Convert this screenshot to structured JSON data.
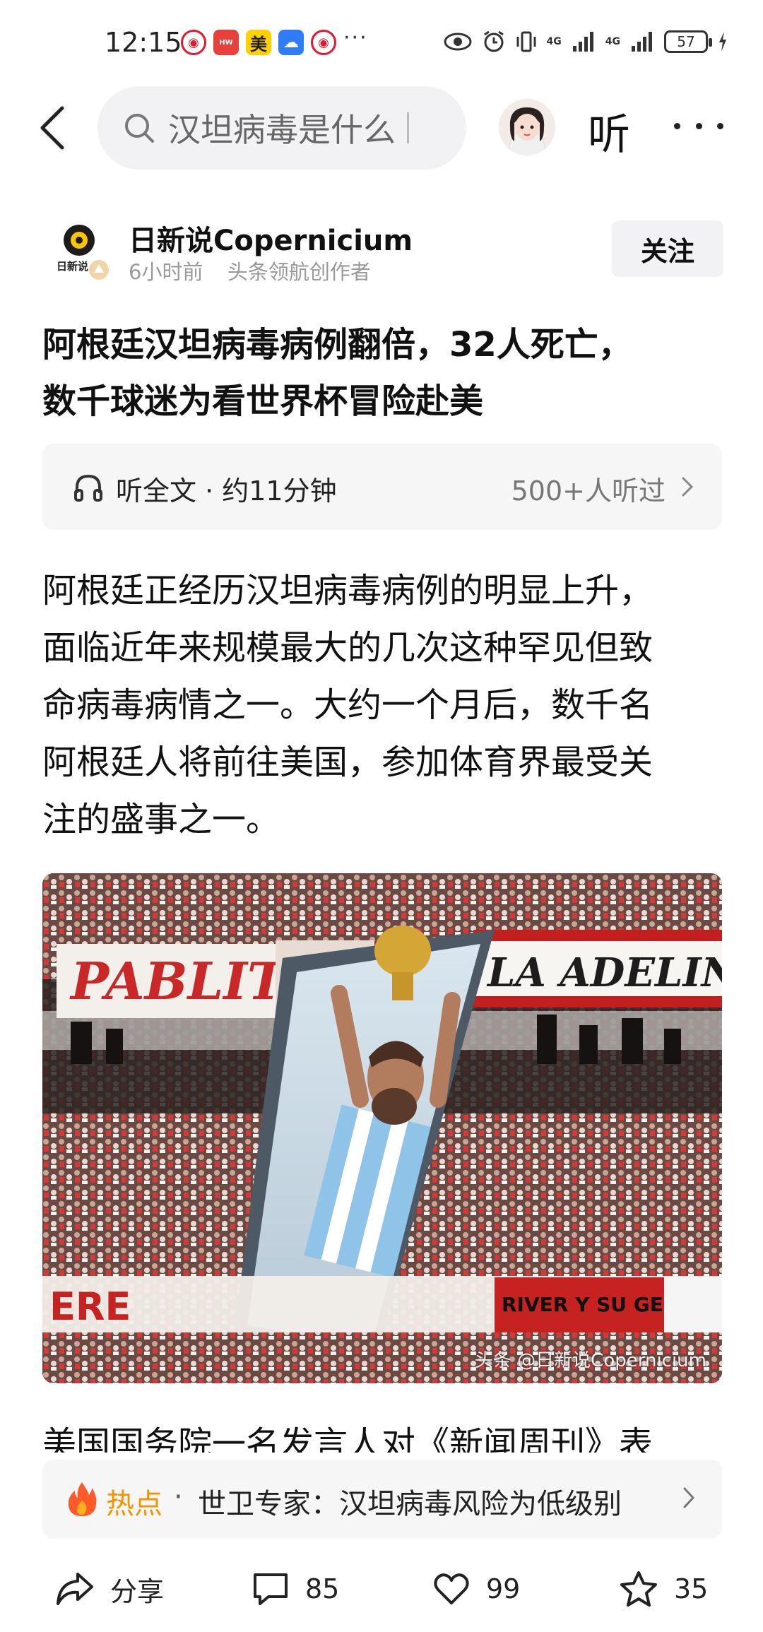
{
  "status_bar": {
    "time": "12:15",
    "apps": [
      "weibo",
      "huawei",
      "美",
      "blue-app",
      "weibo"
    ],
    "more": "···",
    "network_1": "4G",
    "network_2": "4G",
    "battery": "57"
  },
  "top_bar": {
    "search_text": "汉坦病毒是什么",
    "listen_label": "听"
  },
  "author": {
    "name": "日新说Copernicium",
    "time": "6小时前",
    "badge": "头条领航创作者",
    "follow_label": "关注",
    "logo_text": "日新说"
  },
  "article": {
    "title_line1": "阿根廷汉坦病毒病例翻倍，32人死亡，",
    "title_line2": "数千球迷为看世界杯冒险赴美",
    "listen_bar": {
      "label": "听全文 · 约11分钟",
      "count": "500+人听过"
    },
    "paragraph": [
      "阿根廷正经历汉坦病毒病例的明显上升，",
      "面临近年来规模最大的几次这种罕见但致",
      "命病毒病情之一。大约一个月后，数千名",
      "阿根廷人将前往美国，参加体育界最受关",
      "注的盛事之一。"
    ],
    "image_watermark": "头条 @日新说Copernicium",
    "image_banners": {
      "left": "PABLITO",
      "right": "LA ADELINA",
      "bottom_left": "ERE",
      "bottom_right": "RIVER Y SU GENTE"
    },
    "next_paragraph": "美国国务院一名发言人对《新闻周刊》表"
  },
  "hot_bar": {
    "label": "热点",
    "separator": "·",
    "text": "世卫专家：汉坦病毒风险为低级别"
  },
  "bottom_bar": {
    "share_label": "分享",
    "comments": "85",
    "likes": "99",
    "favorites": "35"
  }
}
